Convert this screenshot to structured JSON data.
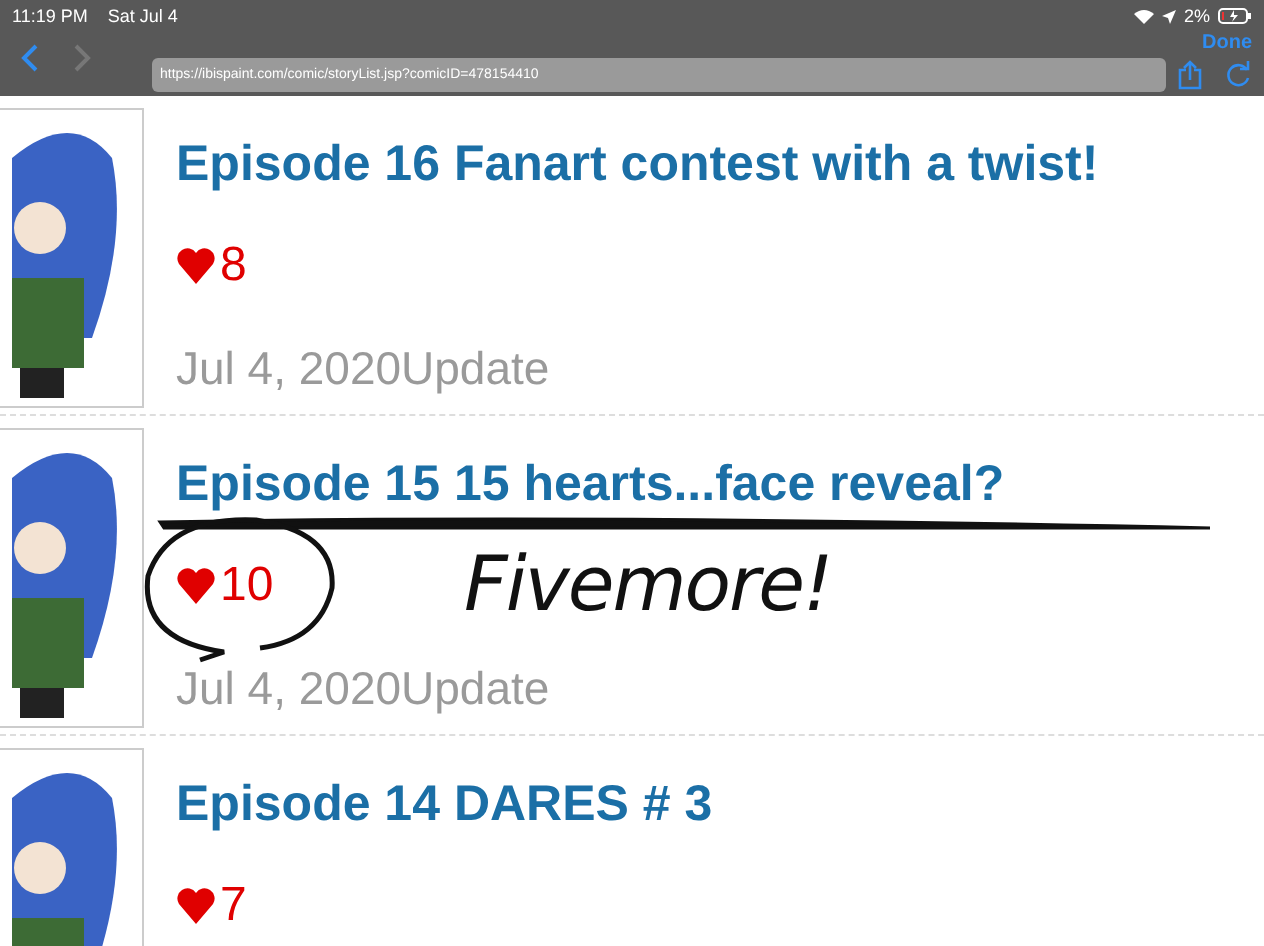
{
  "status_bar": {
    "time": "11:19 PM",
    "date": "Sat Jul 4",
    "battery": "2%"
  },
  "browser": {
    "back": {
      "disabled": false
    },
    "forward": {
      "disabled": true
    },
    "url": "https://ibispaint.com/comic/storyList.jsp?comicID=478154410",
    "done": "Done"
  },
  "episodes": [
    {
      "title": "Episode 16 Fanart contest with a twist!",
      "hearts": "8",
      "date": "Jul 4, 2020Update"
    },
    {
      "title": "Episode 15 15 hearts...face reveal?",
      "hearts": "10",
      "date": "Jul 4, 2020Update",
      "annotation": {
        "note": "Fivemore!"
      }
    },
    {
      "title": "Episode 14 DARES # 3",
      "hearts": "7"
    }
  ]
}
